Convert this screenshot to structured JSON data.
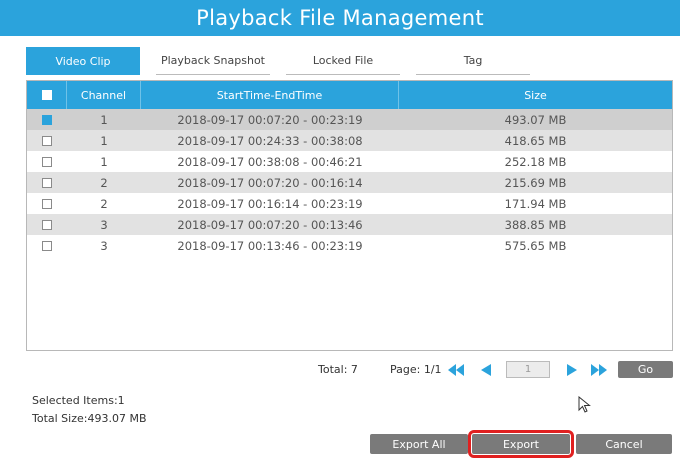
{
  "dialog": {
    "title": "Playback File Management"
  },
  "tabs": [
    {
      "label": "Video Clip",
      "active": true
    },
    {
      "label": "Playback Snapshot",
      "active": false
    },
    {
      "label": "Locked File",
      "active": false
    },
    {
      "label": "Tag",
      "active": false
    }
  ],
  "table": {
    "columns": [
      "Channel",
      "StartTime-EndTime",
      "Size"
    ],
    "rows": [
      {
        "checked": true,
        "channel": "1",
        "time": "2018-09-17 00:07:20 - 00:23:19",
        "size": "493.07 MB"
      },
      {
        "checked": false,
        "channel": "1",
        "time": "2018-09-17 00:24:33 - 00:38:08",
        "size": "418.65 MB"
      },
      {
        "checked": false,
        "channel": "1",
        "time": "2018-09-17 00:38:08 - 00:46:21",
        "size": "252.18 MB"
      },
      {
        "checked": false,
        "channel": "2",
        "time": "2018-09-17 00:07:20 - 00:16:14",
        "size": "215.69 MB"
      },
      {
        "checked": false,
        "channel": "2",
        "time": "2018-09-17 00:16:14 - 00:23:19",
        "size": "171.94 MB"
      },
      {
        "checked": false,
        "channel": "3",
        "time": "2018-09-17 00:07:20 - 00:13:46",
        "size": "388.85 MB"
      },
      {
        "checked": false,
        "channel": "3",
        "time": "2018-09-17 00:13:46 - 00:23:19",
        "size": "575.65 MB"
      }
    ]
  },
  "pager": {
    "total": "Total: 7",
    "page": "Page: 1/1",
    "page_input": "1",
    "go_label": "Go"
  },
  "summary": {
    "selected": "Selected Items:1",
    "total_size": "Total Size:493.07 MB"
  },
  "buttons": {
    "export_all": "Export All",
    "export": "Export",
    "cancel": "Cancel"
  },
  "colors": {
    "accent": "#2ba3dc",
    "button": "#7a7a7a",
    "highlight": "#e02020"
  }
}
